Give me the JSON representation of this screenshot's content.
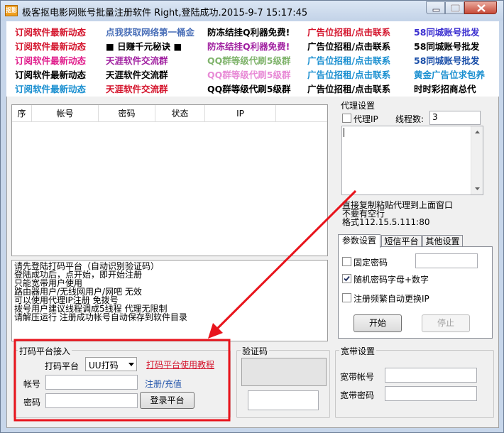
{
  "window": {
    "title": "极客抠电影网账号批量注册软件    Right,登陆成功.2015-9-7 15:17:45",
    "icon_text": "抠影"
  },
  "ads": [
    [
      {
        "text": "订阅软件最新动态",
        "color": "#d4142c"
      },
      {
        "text": "点我获取网络第一桶金",
        "color": "#4a6fb8"
      },
      {
        "text": "防冻结挂Q利器免费!",
        "color": "#000000"
      },
      {
        "text": "广告位招租/点击联系",
        "color": "#d4142c"
      },
      {
        "text": "58同城账号批发",
        "color": "#3b2fd0"
      }
    ],
    [
      {
        "text": "订阅软件最新动态",
        "color": "#d4142c"
      },
      {
        "text": "■ 日赚千元秘诀 ■",
        "color": "#000000"
      },
      {
        "text": "防冻结挂Q利器免费!",
        "color": "#a020a0"
      },
      {
        "text": "广告位招租/点击联系",
        "color": "#000000"
      },
      {
        "text": "58同城账号批发",
        "color": "#000000"
      }
    ],
    [
      {
        "text": "订阅软件最新动态",
        "color": "#e01e8c"
      },
      {
        "text": "天涯软件交流群",
        "color": "#a020a0"
      },
      {
        "text": "QQ群等级代刷5级群",
        "color": "#7fb36b"
      },
      {
        "text": "广告位招租/点击联系",
        "color": "#1a8fd0"
      },
      {
        "text": "58同城账号批发",
        "color": "#1a4ea8"
      }
    ],
    [
      {
        "text": "订阅软件最新动态",
        "color": "#000000"
      },
      {
        "text": "天涯软件交流群",
        "color": "#000000"
      },
      {
        "text": "QQ群等级代刷5级群",
        "color": "#e88ad6"
      },
      {
        "text": "广告位招租/点击联系",
        "color": "#1a8fd0"
      },
      {
        "text": "黄金广告位求包养",
        "color": "#1a8fd0"
      }
    ],
    [
      {
        "text": "订阅软件最新动态",
        "color": "#1a8fd0"
      },
      {
        "text": "天涯软件交流群",
        "color": "#d4142c"
      },
      {
        "text": "QQ群等级代刷5级群",
        "color": "#000000"
      },
      {
        "text": "广告位招租/点击联系",
        "color": "#000000"
      },
      {
        "text": "时时彩招商总代",
        "color": "#000000"
      }
    ]
  ],
  "table": {
    "columns": [
      "序",
      "帐号",
      "密码",
      "状态",
      "IP"
    ],
    "rows": []
  },
  "log_lines": [
    "请先登陆打码平台（自动识别验证码）",
    "登陆成功后，点开始，即开始注册",
    "只能宽带用户使用",
    "路由器用户/无线网用户/网吧 无效",
    "可以使用代理IP注册 免拨号",
    "拨号用户建议线程调成5线程 代理无限制",
    "请解压运行 注册成功帐号自动保存到软件目录"
  ],
  "proxy": {
    "group_title": "代理设置",
    "use_proxy_label": "代理IP",
    "use_proxy_checked": false,
    "threads_label": "线程数:",
    "threads_value": "3",
    "list_value": "",
    "hint1": "直接复制粘贴代理到上面窗口",
    "hint2": "不要有空行",
    "hint3": "格式112.15.5.111:80"
  },
  "tabs": {
    "items": [
      "参数设置",
      "短信平台",
      "其他设置"
    ],
    "active": 0,
    "fixed_password_label": "固定密码",
    "fixed_password_checked": false,
    "fixed_password_value": "",
    "random_password_label": "随机密码字母+数字",
    "random_password_checked": true,
    "auto_ip_label": "注册频繁自动更换IP",
    "auto_ip_checked": false,
    "start_label": "开始",
    "stop_label": "停止"
  },
  "captcha_platform": {
    "group_title": "打码平台接入",
    "platform_label": "打码平台",
    "platform_selected": "UU打码",
    "tutorial_link": "打码平台使用教程",
    "account_label": "帐号",
    "account_value": "",
    "register_link": "注册/充值",
    "password_label": "密码",
    "password_value": "",
    "login_label": "登录平台"
  },
  "captcha": {
    "group_title": "验证码",
    "input_value": ""
  },
  "broadband": {
    "group_title": "宽带设置",
    "account_label": "宽带帐号",
    "account_value": "",
    "password_label": "宽带密码",
    "password_value": ""
  },
  "colors": {
    "annotation": "#e8141c",
    "window_bg": "#f0f0f0",
    "titlebar": "#c7d6ea"
  }
}
